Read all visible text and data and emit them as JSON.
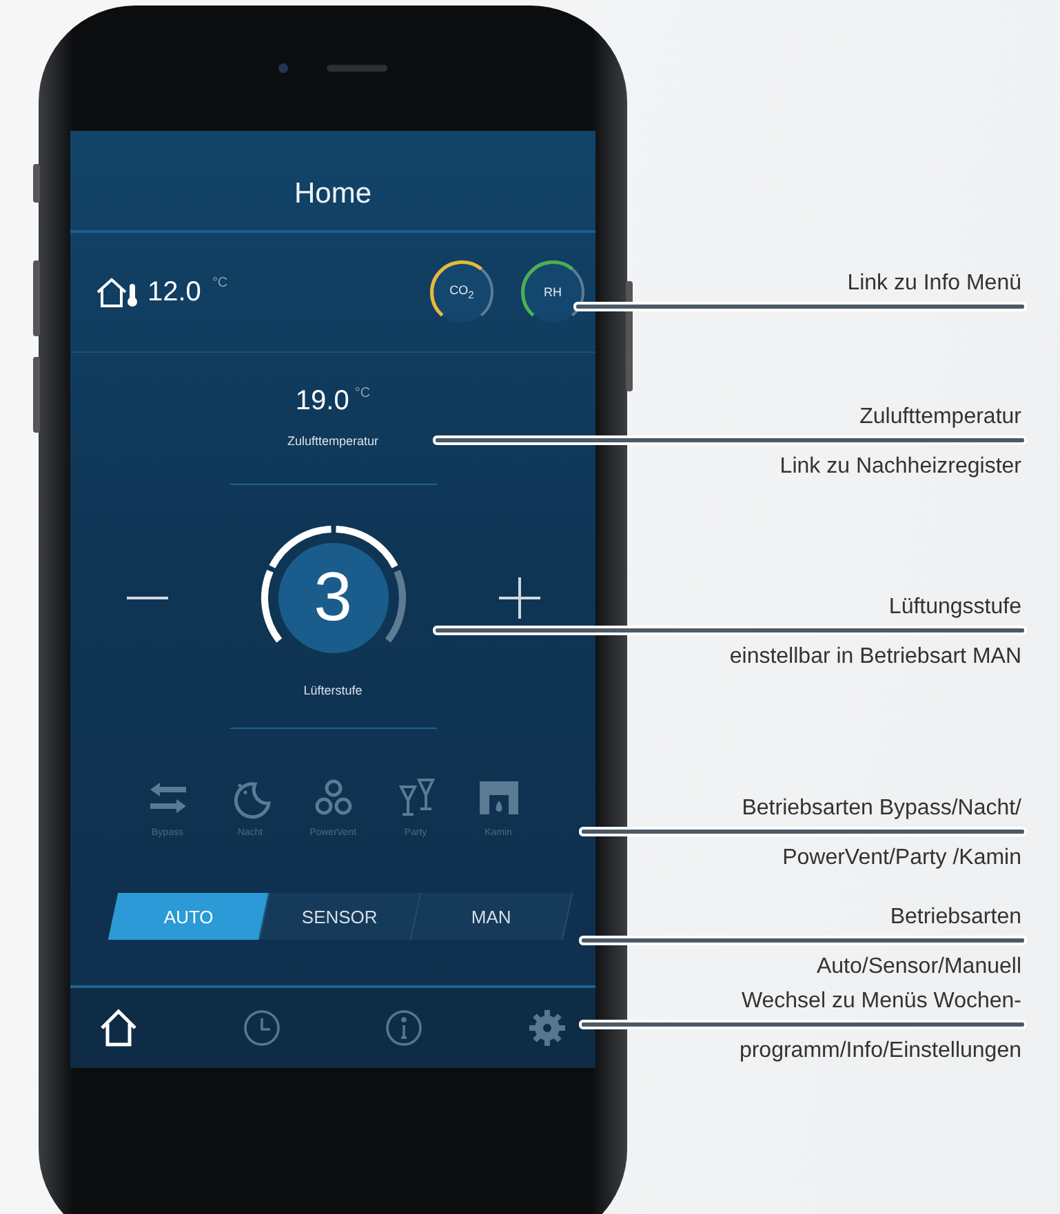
{
  "screen": {
    "title": "Home",
    "outdoor": {
      "value": "12.0",
      "unit": "°C"
    },
    "indicators": [
      {
        "label": "CO$_{2}$",
        "color": "#e8b93a"
      },
      {
        "label": "RH",
        "color": "#4cb050"
      }
    ],
    "supply": {
      "value": "19.0",
      "unit": "°C",
      "label": "Zulufttemperatur"
    },
    "fan": {
      "value": "3",
      "label": "Lüfterstufe",
      "segments": [
        {
          "on": true
        },
        {
          "on": true
        },
        {
          "on": true
        },
        {
          "on": false
        }
      ]
    },
    "modes": [
      {
        "kind": "bypass",
        "label": "Bypass"
      },
      {
        "kind": "night",
        "label": "Nacht"
      },
      {
        "kind": "powervent",
        "label": "PowerVent"
      },
      {
        "kind": "party",
        "label": "Party"
      },
      {
        "kind": "fireplace",
        "label": "Kamin"
      }
    ],
    "operating_modes": [
      {
        "label": "AUTO",
        "selected": true
      },
      {
        "label": "SENSOR",
        "selected": false
      },
      {
        "label": "MAN",
        "selected": false
      }
    ],
    "nav": [
      {
        "kind": "home",
        "selected": true
      },
      {
        "kind": "clock",
        "selected": false
      },
      {
        "kind": "info",
        "selected": false
      },
      {
        "kind": "settings",
        "selected": false
      }
    ]
  },
  "annotations": [
    {
      "above": "Link zu Info Menü"
    },
    {
      "above": "Zulufttemperatur",
      "below": "Link zu Nachheizregister"
    },
    {
      "above": "Lüftungsstufe",
      "below": "einstellbar in Betriebsart MAN"
    },
    {
      "above": "Betriebsarten  Bypass/Nacht/",
      "below": "PowerVent/Party /Kamin"
    },
    {
      "above": "Betriebsarten",
      "below": "Auto/Sensor/Manuell"
    },
    {
      "above": "Wechsel zu Menüs Wochen-",
      "below": "programm/Info/Einstellungen"
    }
  ]
}
